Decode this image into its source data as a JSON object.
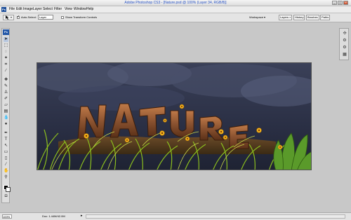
{
  "window": {
    "title": "Adobe Photoshop CS3 - [Nature.psd @ 100% (Layer 34, RGB/8)]",
    "min_label": "_",
    "max_label": "□",
    "close_label": "×"
  },
  "menu": {
    "logo": "Ps",
    "items": [
      "File",
      "Edit",
      "Image",
      "Layer",
      "Select",
      "Filter",
      "View",
      "Window",
      "Help"
    ]
  },
  "options": {
    "auto_select_label": "Auto-Select:",
    "auto_select_value": "Layer",
    "show_transform_label": "Show Transform Controls",
    "workspace_label": "Workspace ▾",
    "panel_tabs": [
      "Layers ×",
      "History",
      "Brushes",
      "Paths"
    ]
  },
  "toolbox": {
    "logo": "Ps"
  },
  "status": {
    "zoom": "100%",
    "doc_info": "Doc: 1.44M/42.0M",
    "arrow": "▸"
  },
  "artwork": {
    "text": "NATURE"
  },
  "colors": {
    "sky": "#2d3348",
    "letters": "#8a5230",
    "grass": "#8cbf1e",
    "flowers": "#f0b01a",
    "title_text": "#2a55c8"
  }
}
